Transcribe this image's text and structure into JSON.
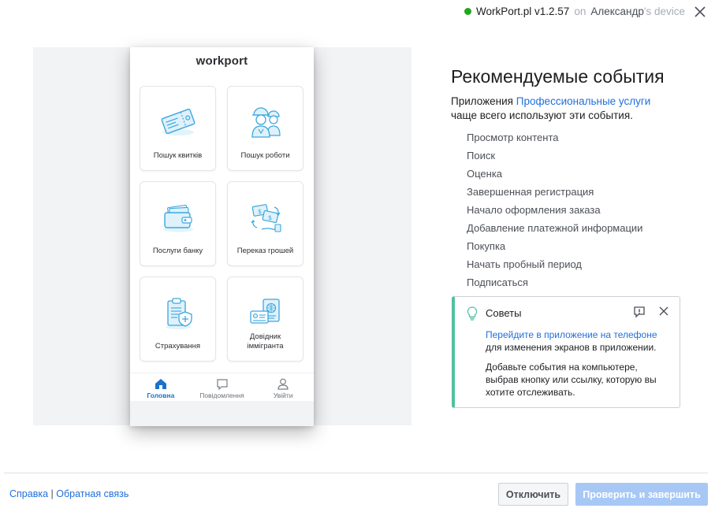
{
  "status": {
    "app": "WorkPort.pl v1.2.57",
    "on": "on",
    "user": "Александр",
    "suffix": "'s device",
    "status_color": "#1fa81b"
  },
  "phone": {
    "logo": "workport",
    "tiles": [
      {
        "label": "Пошук квитків",
        "icon": "ticket-icon"
      },
      {
        "label": "Пошук роботи",
        "icon": "workers-icon"
      },
      {
        "label": "Послуги банку",
        "icon": "wallet-icon"
      },
      {
        "label": "Переказ грошей",
        "icon": "money-transfer-icon"
      },
      {
        "label": "Страхування",
        "icon": "insurance-clipboard-icon"
      },
      {
        "label": "Довідник іммігранта",
        "icon": "passport-icon"
      }
    ],
    "tabs": [
      {
        "label": "Головна",
        "icon": "home-icon",
        "active": true
      },
      {
        "label": "Повідомлення",
        "icon": "message-icon",
        "active": false
      },
      {
        "label": "Увійти",
        "icon": "user-icon",
        "active": false
      }
    ]
  },
  "panel": {
    "title": "Рекомендуемые события",
    "intro_prefix": "Приложения ",
    "intro_link": "Профессиональные услуги",
    "intro_suffix": "чаще всего используют эти события.",
    "events": [
      "Просмотр контента",
      "Поиск",
      "Оценка",
      "Завершенная регистрация",
      "Начало оформления заказа",
      "Добавление платежной информации",
      "Покупка",
      "Начать пробный период",
      "Подписаться"
    ]
  },
  "tips": {
    "title": "Советы",
    "p1_link": "Перейдите в приложение на телефоне",
    "p1_rest": "для изменения экранов в приложении.",
    "p2": "Добавьте события на компьютере, выбрав кнопку или ссылку, которую вы хотите отслеживать.",
    "accent_color": "#51c1a0"
  },
  "footer": {
    "help": "Справка",
    "separator": "|",
    "feedback": "Обратная связь",
    "disable_button": "Отключить",
    "finish_button": "Проверить и завершить"
  },
  "colors": {
    "link": "#216fdb",
    "primary_disabled": "#a7c8f5",
    "tab_active": "#1a73c8",
    "icon_blue": "#3aa7de"
  }
}
